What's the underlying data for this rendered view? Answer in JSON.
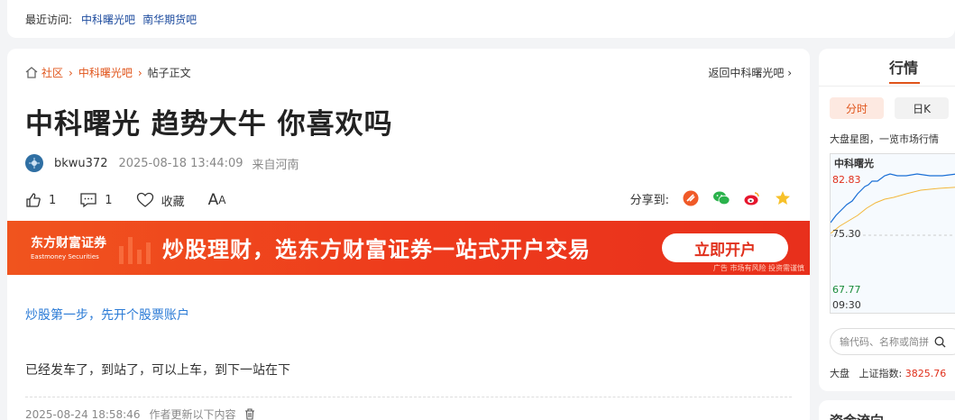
{
  "recent": {
    "label": "最近访问:",
    "links": [
      "中科曙光吧",
      "南华期货吧"
    ]
  },
  "breadcrumb": {
    "home": "社区",
    "bar": "中科曙光吧",
    "current": "帖子正文"
  },
  "back_link": "返回中科曙光吧",
  "post": {
    "title": "中科曙光 趋势大牛 你喜欢吗",
    "author": "bkwu372",
    "time": "2025-08-18 13:44:09",
    "location": "来自河南",
    "likes": "1",
    "comments": "1",
    "favorite_label": "收藏",
    "font_label": "A",
    "font_label_small": "A",
    "share_label": "分享到:",
    "promo_link": "炒股第一步，先开个股票账户",
    "body": "已经发车了，到站了，可以上车，到下一站在下",
    "update_time": "2025-08-24 18:58:46",
    "update_text": "作者更新以下内容"
  },
  "banner": {
    "brand_cn": "东方财富证券",
    "brand_en": "Eastmoney Securities",
    "slogan": "炒股理财，选东方财富证券一站式开户交易",
    "cta": "立即开户",
    "note": "广告 市场有风险 投资需谨慎"
  },
  "sidebar": {
    "tab": "行情",
    "seg_on": "分时",
    "seg_off": "日K",
    "desc": "大盘星图，一览市场行情",
    "chart_name": "中科曙光",
    "price_high": "82.83",
    "price_mid": "75.30",
    "price_low": "67.77",
    "time_start": "09:30",
    "search_placeholder": "输代码、名称或简拼",
    "index_label": "大盘",
    "index_name": "上证指数:",
    "index_value": "3825.76",
    "section2": "资金流向"
  },
  "colors": {
    "accent": "#e0541a",
    "link": "#2b7bd6",
    "up": "#e0301c",
    "down": "#1a8c3a"
  },
  "icons": [
    "home-icon",
    "chevron-right-icon",
    "thumb-up-icon",
    "comment-icon",
    "heart-icon",
    "weibo-icon",
    "wechat-icon",
    "qzone-icon",
    "delete-icon",
    "search-icon"
  ]
}
